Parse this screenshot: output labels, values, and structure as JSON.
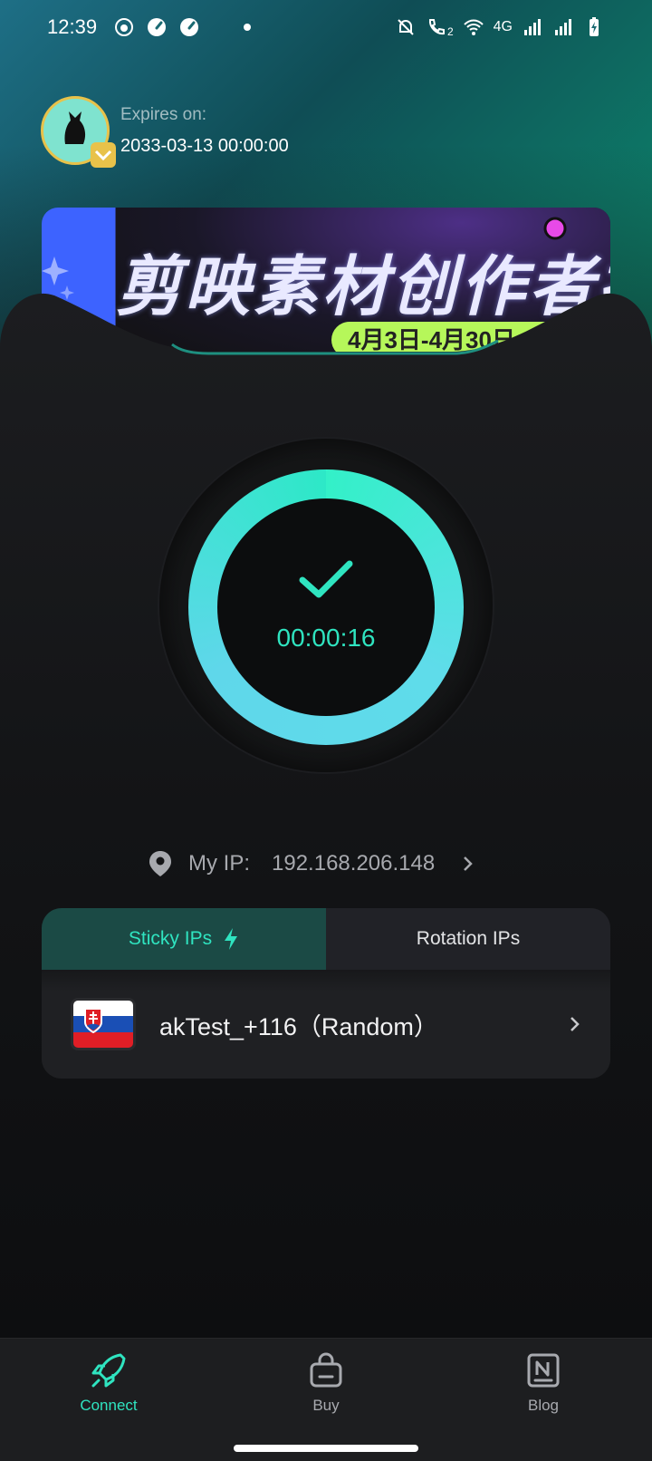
{
  "status_bar": {
    "time": "12:39",
    "network": "4G",
    "sim_badge": "2"
  },
  "account": {
    "expires_label": "Expires on:",
    "expires_date": "2033-03-13 00:00:00"
  },
  "banner": {
    "headline": "剪映素材创作者招",
    "date_text": "4月3日-4月30日"
  },
  "connection": {
    "state": "connected",
    "timer": "00:00:16"
  },
  "my_ip": {
    "label": "My IP:",
    "value": "192.168.206.148"
  },
  "tabs": [
    {
      "label": "Sticky IPs",
      "active": true
    },
    {
      "label": "Rotation IPs",
      "active": false
    }
  ],
  "server": {
    "name": "akTest_+116（Random）",
    "flag": "slovakia-flag"
  },
  "bottom_nav": [
    {
      "label": "Connect",
      "icon": "rocket-icon",
      "active": true
    },
    {
      "label": "Buy",
      "icon": "shopping-bag-icon",
      "active": false
    },
    {
      "label": "Blog",
      "icon": "notion-icon",
      "active": false
    }
  ],
  "colors": {
    "accent": "#2fe4c0",
    "ring_start": "#33f0c8",
    "ring_end": "#5fd7ea",
    "avatar_border": "#e8c24a",
    "banner_badge": "#b6f75a"
  }
}
